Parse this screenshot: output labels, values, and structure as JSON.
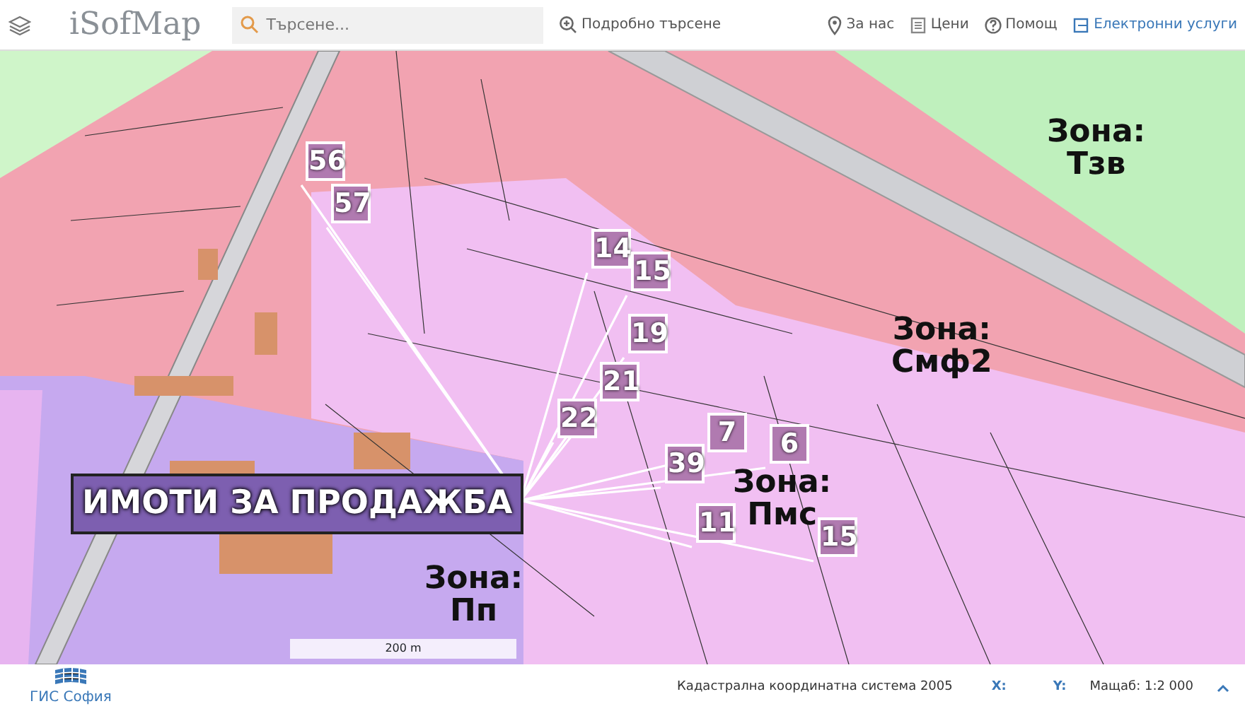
{
  "header": {
    "logo": "iSofMap",
    "search": {
      "placeholder": "Търсене..."
    },
    "advanced_search": "Подробно търсене",
    "nav": [
      {
        "kind": "pin",
        "label": "За нас"
      },
      {
        "kind": "list",
        "label": "Цени"
      },
      {
        "kind": "help",
        "label": "Помощ"
      },
      {
        "kind": "services",
        "label": "Електронни услуги"
      }
    ]
  },
  "map": {
    "overlay_label": "ИМОТИ ЗА ПРОДАЖБА",
    "markers": [
      {
        "label": "56"
      },
      {
        "label": "57"
      },
      {
        "label": "14"
      },
      {
        "label": "15"
      },
      {
        "label": "19"
      },
      {
        "label": "21"
      },
      {
        "label": "22"
      },
      {
        "label": "7"
      },
      {
        "label": "6"
      },
      {
        "label": "39"
      },
      {
        "label": "11"
      },
      {
        "label": "15"
      }
    ],
    "zones": [
      {
        "label": "Зона:",
        "code": "Тзв"
      },
      {
        "label": "Зона:",
        "code": "Смф2"
      },
      {
        "label": "Зона:",
        "code": "Пмс"
      },
      {
        "label": "Зона:",
        "code": "Пп"
      }
    ],
    "scale": "200 m"
  },
  "footer": {
    "logo": "ГИС София",
    "coordinate_system": "Кадастрална координатна система 2005",
    "x_label": "X:",
    "y_label": "Y:",
    "scale": "Мащаб: 1:2 000"
  }
}
